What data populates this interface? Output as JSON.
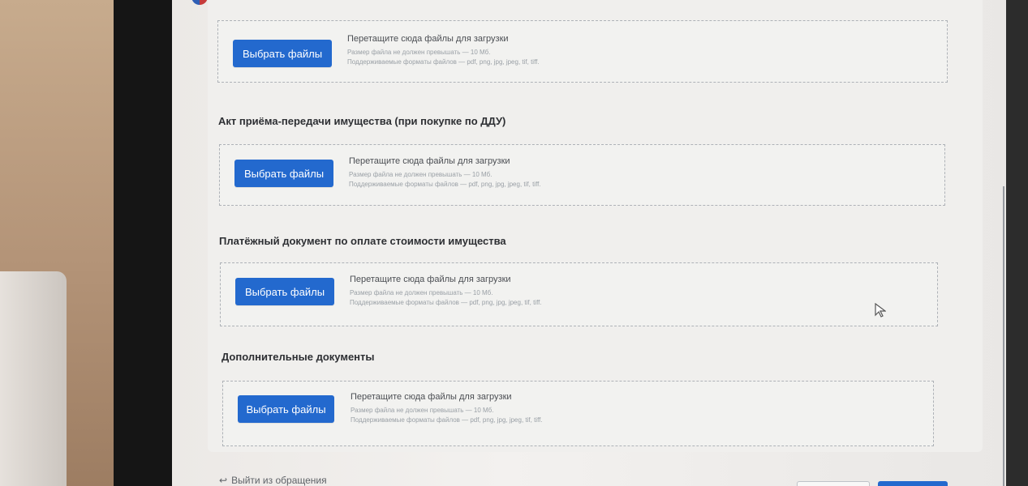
{
  "upload": {
    "button_label": "Выбрать файлы",
    "drop_title": "Перетащите сюда файлы для загрузки",
    "size_note": "Размер файла не должен превышать — 10 Мб.",
    "format_note": "Поддерживаемые форматы файлов — pdf, png, jpg, jpeg, tif, tiff."
  },
  "sections": [
    {
      "heading": ""
    },
    {
      "heading": "Акт приёма-передачи имущества (при покупке по ДДУ)"
    },
    {
      "heading": "Платёжный документ по оплате стоимости имущества"
    },
    {
      "heading": "Дополнительные документы"
    }
  ],
  "footer": {
    "exit_link": "Выйти из обращения",
    "exit_icon": "logout-icon"
  },
  "colors": {
    "accent": "#2369ce",
    "dropzone_border": "#aeb2b7",
    "heading": "#2d2f33"
  },
  "icons": {
    "cursor": "mouse-pointer-icon",
    "logo": "logo-icon"
  }
}
